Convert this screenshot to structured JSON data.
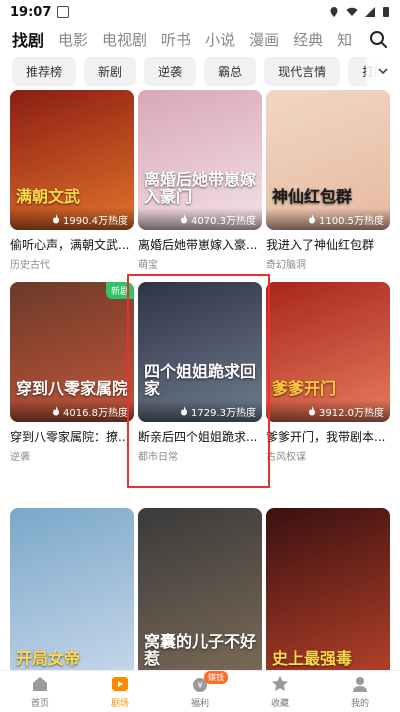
{
  "status_bar": {
    "time": "19:07"
  },
  "category_tabs": [
    {
      "label": "找剧",
      "active": true
    },
    {
      "label": "电影"
    },
    {
      "label": "电视剧"
    },
    {
      "label": "听书"
    },
    {
      "label": "小说"
    },
    {
      "label": "漫画"
    },
    {
      "label": "经典"
    },
    {
      "label": "知"
    }
  ],
  "tags": [
    "推荐榜",
    "新剧",
    "逆袭",
    "霸总",
    "现代言情",
    "打脸"
  ],
  "cards": [
    {
      "title": "偷听心声，满朝文武...",
      "genre": "历史古代",
      "heat": "1990.4万热度",
      "overlay": "满朝文武",
      "overlay_color": "#ffd94a",
      "bg": [
        "#8a1e12",
        "#e2732c"
      ]
    },
    {
      "title": "离婚后她带崽嫁入豪...",
      "genre": "萌宝",
      "heat": "4070.3万热度",
      "overlay": "离婚后她带崽嫁入豪门",
      "overlay_color": "#ffffff",
      "bg": [
        "#d9a7b5",
        "#f2e1e6"
      ]
    },
    {
      "title": "我进入了神仙红包群",
      "genre": "奇幻脑洞",
      "heat": "1100.5万热度",
      "overlay": "神仙红包群",
      "overlay_color": "#1a1a1a",
      "bg": [
        "#f0d7c4",
        "#e7b9a0"
      ]
    },
    {
      "title": "穿到八零家属院：撩...",
      "genre": "逆袭",
      "heat": "4016.8万热度",
      "overlay": "穿到八零家属院",
      "overlay_color": "#ffffff",
      "bg": [
        "#6b3a2a",
        "#c4563a"
      ],
      "badge": "新剧"
    },
    {
      "title": "断亲后四个姐姐跪求...",
      "genre": "都市日常",
      "heat": "1729.3万热度",
      "overlay": "四个姐姐跪求回家",
      "overlay_color": "#ffffff",
      "bg": [
        "#2d3545",
        "#6f7b8f"
      ]
    },
    {
      "title": "爹爹开门，我带剧本...",
      "genre": "古风权谋",
      "heat": "3912.0万热度",
      "overlay": "爹爹开门",
      "overlay_color": "#ffcb3a",
      "bg": [
        "#a8261c",
        "#e67b5d"
      ]
    },
    {
      "title": "",
      "genre": "",
      "heat": "",
      "overlay": "开局女帝",
      "overlay_color": "#ffd94a",
      "bg": [
        "#7aa7c9",
        "#c7d7ea"
      ]
    },
    {
      "title": "",
      "genre": "",
      "heat": "",
      "overlay": "窝囊的儿子不好惹",
      "overlay_color": "#ffffff",
      "bg": [
        "#3a3a3a",
        "#7c6a57"
      ]
    },
    {
      "title": "",
      "genre": "",
      "heat": "",
      "overlay": "史上最强毒",
      "overlay_color": "#ffd94a",
      "bg": [
        "#3a1010",
        "#b4412a"
      ]
    }
  ],
  "bottom_nav": [
    {
      "label": "首页",
      "icon": "home-icon"
    },
    {
      "label": "剧场",
      "icon": "play-icon",
      "active": true
    },
    {
      "label": "福利",
      "icon": "welfare-icon",
      "badge": "赚钱"
    },
    {
      "label": "收藏",
      "icon": "star-icon"
    },
    {
      "label": "我的",
      "icon": "user-icon"
    }
  ],
  "colors": {
    "accent": "#ff8a00",
    "highlight_border": "#e8302f",
    "new_badge": "#33c26b"
  }
}
